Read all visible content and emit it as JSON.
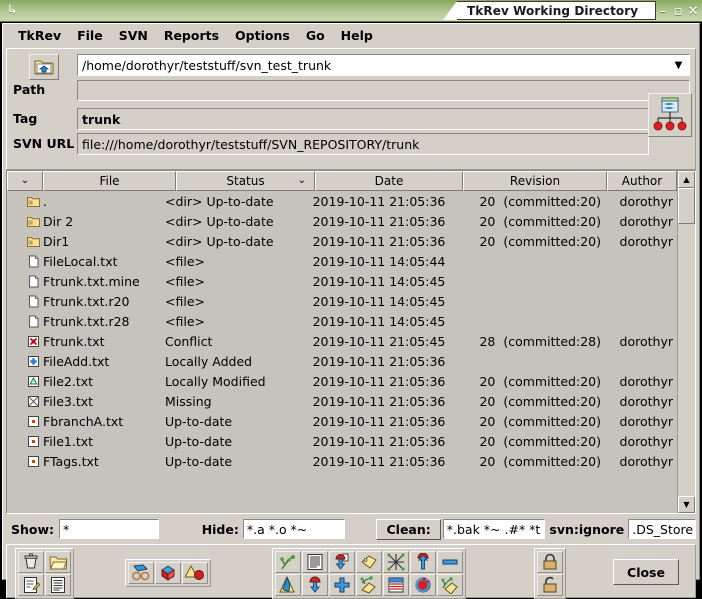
{
  "window": {
    "title": "TkRev Working Directory",
    "titlebar_icon": "app-arrow-icon",
    "minimize": "–",
    "maximize": "▫",
    "close": "✕"
  },
  "menubar": {
    "items": [
      {
        "label": "TkRev",
        "mnemonic": ""
      },
      {
        "label": "File",
        "mnemonic": "F"
      },
      {
        "label": "SVN",
        "mnemonic": ""
      },
      {
        "label": "Reports",
        "mnemonic": "R"
      },
      {
        "label": "Options",
        "mnemonic": "O"
      },
      {
        "label": "Go",
        "mnemonic": "G"
      },
      {
        "label": "Help",
        "mnemonic": "H"
      }
    ]
  },
  "path_panel": {
    "browse_icon": "folder-home-icon",
    "combo_value": "/home/dorothyr/teststuff/svn_test_trunk",
    "combo_arrow": "▼",
    "path_label": "Path",
    "path_value": "",
    "tag_label": "Tag",
    "tag_value": "trunk",
    "svnurl_label": "SVN URL",
    "svnurl_value": "file:///home/dorothyr/teststuff/SVN_REPOSITORY/trunk",
    "repo_icon": "repository-tree-icon"
  },
  "filelist": {
    "columns": [
      {
        "key": "sortcol",
        "label": "",
        "sort": "⌄"
      },
      {
        "key": "file",
        "label": "File",
        "sort": ""
      },
      {
        "key": "status",
        "label": "Status",
        "sort": "⌄"
      },
      {
        "key": "date",
        "label": "Date",
        "sort": ""
      },
      {
        "key": "rev",
        "label": "Revision",
        "sort": ""
      },
      {
        "key": "author",
        "label": "Author",
        "sort": ""
      }
    ],
    "rows": [
      {
        "icon": "folder-icon",
        "file": ".",
        "status": "<dir> Up-to-date",
        "date": "2019-10-11 21:05:36",
        "rev": "20",
        "revtext": "(committed:20)",
        "author": "dorothyr"
      },
      {
        "icon": "folder-icon",
        "file": "Dir 2",
        "status": "<dir> Up-to-date",
        "date": "2019-10-11 21:05:36",
        "rev": "20",
        "revtext": "(committed:20)",
        "author": "dorothyr"
      },
      {
        "icon": "folder-icon",
        "file": "Dir1",
        "status": "<dir> Up-to-date",
        "date": "2019-10-11 21:05:36",
        "rev": "20",
        "revtext": "(committed:20)",
        "author": "dorothyr"
      },
      {
        "icon": "blank-file-icon",
        "file": "FileLocal.txt",
        "status": "<file>",
        "date": "2019-10-11 14:05:44",
        "rev": "",
        "revtext": "",
        "author": ""
      },
      {
        "icon": "blank-file-icon",
        "file": "Ftrunk.txt.mine",
        "status": "<file>",
        "date": "2019-10-11 14:05:45",
        "rev": "",
        "revtext": "",
        "author": ""
      },
      {
        "icon": "blank-file-icon",
        "file": "Ftrunk.txt.r20",
        "status": "<file>",
        "date": "2019-10-11 14:05:45",
        "rev": "",
        "revtext": "",
        "author": ""
      },
      {
        "icon": "blank-file-icon",
        "file": "Ftrunk.txt.r28",
        "status": "<file>",
        "date": "2019-10-11 14:05:45",
        "rev": "",
        "revtext": "",
        "author": ""
      },
      {
        "icon": "conflict-icon",
        "file": "Ftrunk.txt",
        "status": "Conflict",
        "date": "2019-10-11 21:05:45",
        "rev": "28",
        "revtext": "(committed:28)",
        "author": "dorothyr"
      },
      {
        "icon": "added-icon",
        "file": "FileAdd.txt",
        "status": "Locally Added",
        "date": "2019-10-11 21:05:36",
        "rev": "",
        "revtext": "",
        "author": ""
      },
      {
        "icon": "modified-icon",
        "file": "File2.txt",
        "status": "Locally Modified",
        "date": "2019-10-11 21:05:36",
        "rev": "20",
        "revtext": "(committed:20)",
        "author": "dorothyr"
      },
      {
        "icon": "missing-icon",
        "file": "File3.txt",
        "status": "Missing",
        "date": "2019-10-11 21:05:36",
        "rev": "20",
        "revtext": "(committed:20)",
        "author": "dorothyr"
      },
      {
        "icon": "uptodate-file-icon",
        "file": "FbranchA.txt",
        "status": "Up-to-date",
        "date": "2019-10-11 21:05:36",
        "rev": "20",
        "revtext": "(committed:20)",
        "author": "dorothyr"
      },
      {
        "icon": "uptodate-file-icon",
        "file": "File1.txt",
        "status": "Up-to-date",
        "date": "2019-10-11 21:05:36",
        "rev": "20",
        "revtext": "(committed:20)",
        "author": "dorothyr"
      },
      {
        "icon": "uptodate-file-icon",
        "file": "FTags.txt",
        "status": "Up-to-date",
        "date": "2019-10-11 21:05:36",
        "rev": "20",
        "revtext": "(committed:20)",
        "author": "dorothyr"
      }
    ],
    "scroll_up": "▲",
    "scroll_down": "▼"
  },
  "filterbar": {
    "show_label": "Show:",
    "show_value": "*",
    "hide_label": "Hide:",
    "hide_value": "*.a *.o *~",
    "clean_label": "Clean:",
    "clean_value": "*.bak *~ .#* *t",
    "svnignore_label": "svn:ignore",
    "svnignore_value": ".DS_Store"
  },
  "toolbar": {
    "group1": [
      {
        "icon": "delete-trash-icon"
      },
      {
        "icon": "edit-file-icon"
      },
      {
        "icon": "new-folder-icon"
      },
      {
        "icon": "file-view-icon"
      }
    ],
    "group2": [
      {
        "icon": "view-glasses-icon"
      },
      {
        "icon": "diff-cube-icon"
      },
      {
        "icon": "shapes-icon"
      }
    ],
    "group3": [
      {
        "icon": "branch-icon"
      },
      {
        "icon": "annotate-icon"
      },
      {
        "icon": "log-lines-icon"
      },
      {
        "icon": "update-down-icon"
      },
      {
        "icon": "checkout-down-icon"
      },
      {
        "icon": "add-plus-icon"
      },
      {
        "icon": "tag-icon"
      },
      {
        "icon": "branch-merge-icon"
      },
      {
        "icon": "revert-cross-icon"
      },
      {
        "icon": "log-table-icon"
      },
      {
        "icon": "commit-up-icon"
      },
      {
        "icon": "revert-icon"
      },
      {
        "icon": "remove-minus-icon"
      },
      {
        "icon": "tag-branch-icon"
      }
    ],
    "group4": [
      {
        "icon": "lock-icon"
      },
      {
        "icon": "unlock-icon"
      }
    ],
    "close_label": "Close"
  }
}
